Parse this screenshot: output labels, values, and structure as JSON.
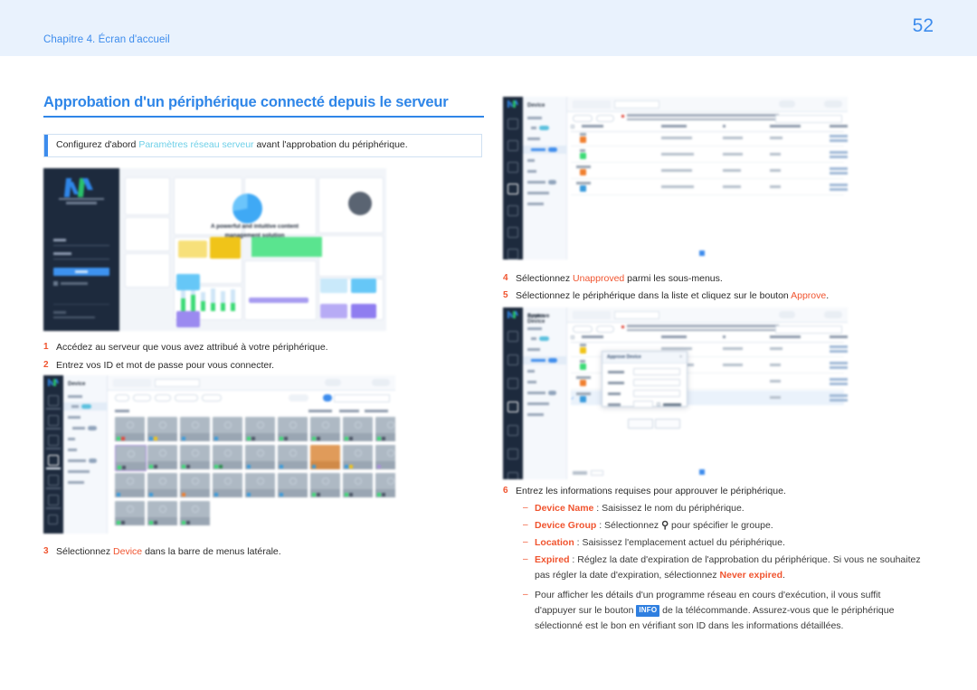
{
  "header": {
    "chapter": "Chapitre 4. Écran d'accueil",
    "page_number": "52",
    "band_color": "#e9f2fd",
    "accent_color": "#3d8ced"
  },
  "title": {
    "text": "Approbation d'un périphérique connecté depuis le serveur",
    "color": "#2f86e8"
  },
  "note": {
    "prefix": "Configurez d'abord ",
    "link": "Paramètres réseau serveur",
    "suffix": " avant l'approbation du périphérique.",
    "link_color": "#6fd0e8",
    "bar_color": "#3d8ced"
  },
  "steps": {
    "step1": {
      "num": "1",
      "text": "Accédez au serveur que vous avez attribué à votre périphérique."
    },
    "step2": {
      "num": "2",
      "text": "Entrez vos ID et mot de passe pour vous connecter."
    },
    "step3": {
      "num": "3",
      "prefix": "Sélectionnez ",
      "highlight": "Device",
      "suffix": " dans la barre de menus latérale."
    },
    "step4": {
      "num": "4",
      "prefix": "Sélectionnez ",
      "highlight": "Unapproved",
      "suffix": " parmi les sous-menus."
    },
    "step5": {
      "num": "5",
      "prefix": "Sélectionnez le périphérique dans la liste et cliquez sur le bouton ",
      "highlight": "Approve",
      "suffix": "."
    },
    "step6": {
      "num": "6",
      "text": "Entrez les informations requises pour approuver le périphérique."
    }
  },
  "sub_items": {
    "device_name": {
      "key": "Device Name",
      "text": " : Saisissez le nom du périphérique."
    },
    "device_group": {
      "key": "Device Group",
      "before": " : Sélectionnez ",
      "icon": "search-icon",
      "icon_glyph": "Q",
      "after": " pour spécifier le groupe."
    },
    "location": {
      "key": "Location",
      "text": " : Saisissez l'emplacement actuel du périphérique."
    },
    "expired": {
      "key": "Expired",
      "text_1": " : Réglez la date d'expiration de l'approbation du périphérique. Si vous ne souhaitez",
      "text_2": "pas régler la date d'expiration, sélectionnez ",
      "never": "Never expired",
      "text_3": "."
    },
    "info": {
      "line1": "Pour afficher les détails d'un programme réseau en cours d'exécution, il vous suffit",
      "line2_before": "d'appuyer sur le bouton ",
      "badge": "INFO",
      "line2_after": " de la télécommande. Assurez-vous que le périphérique",
      "line3": "sélectionné est le bon en vérifiant son ID dans les informations détaillées."
    }
  },
  "highlight_color": "#f0542f",
  "screenshots": {
    "login": {
      "name": "magicinfo-server-login-screen",
      "brand": "MagicInfo Server",
      "username_placeholder": "admin",
      "password_placeholder": "Password",
      "signin_label": "Sign in",
      "remember_label": "Remember my ID",
      "promo_title_line1": "A powerful and intuitive content",
      "promo_title_line2": "management solution"
    },
    "device_list": {
      "name": "device-list-thumbnail-view",
      "sidebar_title": "Device",
      "tabs": [
        "Dashboard",
        "Device"
      ],
      "active_tab": "Device",
      "sidebar_items": [
        "All",
        "Group",
        "Unapproved",
        "POP",
        "Alert",
        "Notification",
        "Software Update",
        "Device List"
      ]
    },
    "unapproved_list": {
      "name": "device-unapproved-list",
      "sidebar_title": "Device",
      "tabs": [
        "Dashboard",
        "Unapproved"
      ],
      "active_tab": "Unapproved",
      "toolbar_buttons": [
        "Approve",
        "Delete"
      ],
      "columns": [
        "Device Name",
        "MAC Address",
        "IP",
        "Device Model Name",
        "Registered"
      ],
      "row_count": 4
    },
    "approve_dialog": {
      "name": "approve-device-dialog",
      "dialog_title": "Approve Device",
      "fields": [
        "Device Name",
        "Device Group",
        "Location",
        "Expired"
      ],
      "ok_label": "OK",
      "cancel_label": "Cancel",
      "never_expired_label": "Never expired"
    }
  }
}
